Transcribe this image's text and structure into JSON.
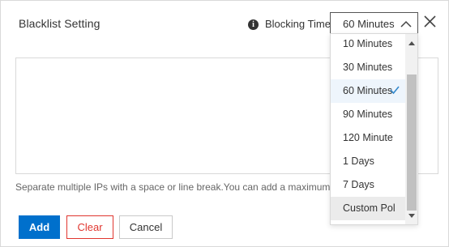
{
  "dialog": {
    "title": "Blacklist Setting",
    "blocking_time_label": "Blocking Time",
    "selected_value": "60 Minutes",
    "hint": "Separate multiple IPs with a space or line break.You can add a maximum of",
    "buttons": {
      "add": "Add",
      "clear": "Clear",
      "cancel": "Cancel"
    },
    "icons": {
      "info": "info-icon",
      "close": "close-icon",
      "arrow": "chevron-up-icon",
      "check": "check-icon"
    }
  },
  "dropdown": {
    "options": [
      "10 Minutes",
      "30 Minutes",
      "60 Minutes",
      "90 Minutes",
      "120 Minute",
      "1 Days",
      "7 Days",
      "Custom Pol"
    ],
    "selected": "60 Minutes",
    "hovered": "Custom Pol"
  },
  "colors": {
    "primary": "#0070cc",
    "danger": "#e0362f",
    "selected_bg": "#eef5fc",
    "check": "#3388cc"
  }
}
